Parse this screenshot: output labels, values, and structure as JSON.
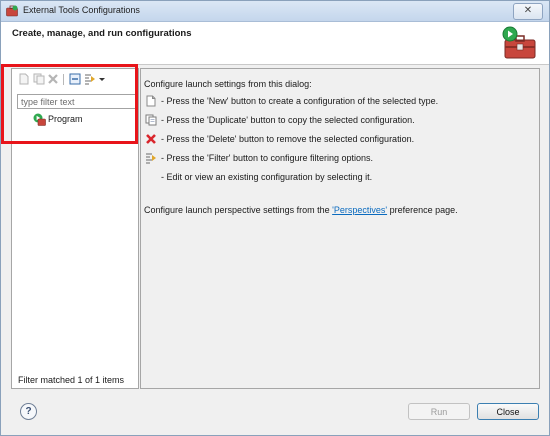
{
  "window": {
    "title": "External Tools Configurations",
    "close_glyph": "✕"
  },
  "header": {
    "title": "Create, manage, and run configurations",
    "icon": "toolbox-run-icon"
  },
  "toolbar": {
    "buttons": [
      {
        "name": "new-config-icon",
        "enabled": false
      },
      {
        "name": "duplicate-config-icon",
        "enabled": false
      },
      {
        "name": "delete-config-icon",
        "enabled": false
      },
      {
        "name": "collapse-all-icon",
        "enabled": true
      },
      {
        "name": "filter-icon",
        "enabled": true
      },
      {
        "name": "view-menu-chevron-icon",
        "enabled": true
      }
    ]
  },
  "filter": {
    "placeholder": "type filter text",
    "value": ""
  },
  "tree": {
    "items": [
      {
        "label": "Program",
        "icon": "program-run-icon"
      }
    ]
  },
  "left_status": "Filter matched 1 of 1 items",
  "info": {
    "intro": "Configure launch settings from this dialog:",
    "lines": [
      {
        "icon": "new-config-icon",
        "text": "- Press the 'New' button to create a configuration of the selected type."
      },
      {
        "icon": "duplicate-config-icon",
        "text": "- Press the 'Duplicate' button to copy the selected configuration."
      },
      {
        "icon": "delete-config-icon",
        "text": "- Press the 'Delete' button to remove the selected configuration."
      },
      {
        "icon": "filter-icon",
        "text": "- Press the 'Filter' button to configure filtering options."
      },
      {
        "icon": "",
        "text": "- Edit or view an existing configuration by selecting it."
      }
    ],
    "perspective_prefix": "Configure launch perspective settings from the ",
    "perspective_link": "'Perspectives'",
    "perspective_suffix": " preference page."
  },
  "footer": {
    "help_glyph": "?",
    "run_label": "Run",
    "close_label": "Close"
  },
  "colors": {
    "highlight": "#e8141a",
    "link": "#0b6bbf",
    "delete_red": "#d9262c"
  }
}
